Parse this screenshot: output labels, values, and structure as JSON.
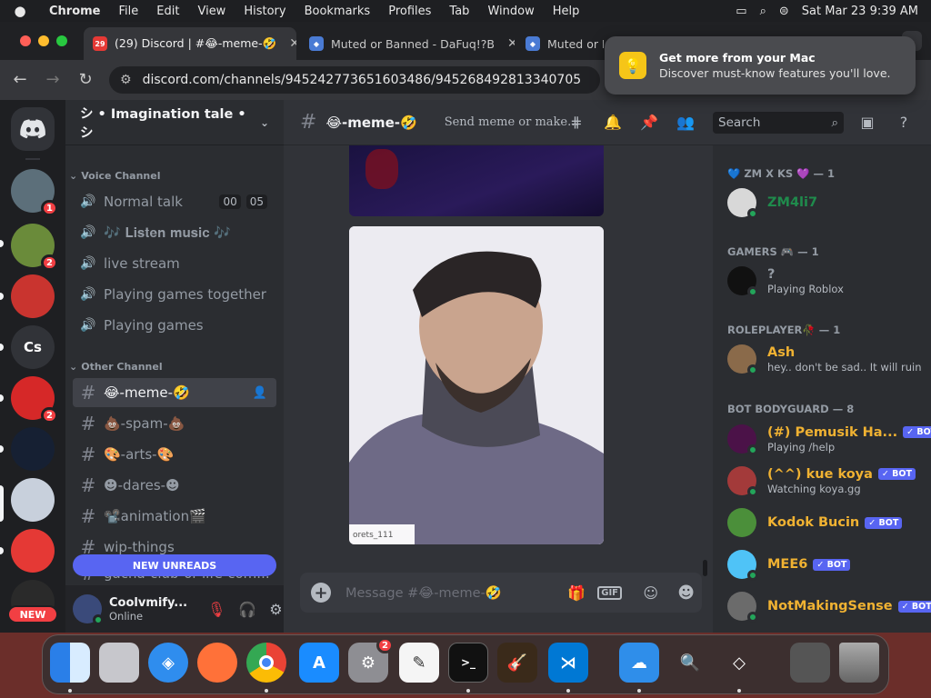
{
  "menubar": {
    "app": "Chrome",
    "items": [
      "File",
      "Edit",
      "View",
      "History",
      "Bookmarks",
      "Profiles",
      "Tab",
      "Window",
      "Help"
    ],
    "datetime": "Sat Mar 23  9:39 AM"
  },
  "browser": {
    "tabs": [
      {
        "title": "(29) Discord | #😂-meme-🤣",
        "favicon": "29"
      },
      {
        "title": "Muted or Banned - DaFuq!?B",
        "favicon": ""
      },
      {
        "title": "Muted or Ba",
        "favicon": ""
      }
    ],
    "url": "discord.com/channels/945242773651603486/945268492813340705"
  },
  "notification": {
    "title": "Get more from your Mac",
    "body": "Discover must-know features you'll love."
  },
  "discord": {
    "server_name": "シ • Imagination tale • シ",
    "guilds": [
      {
        "label": "",
        "badge": "1",
        "color": "#5c6f7a"
      },
      {
        "label": "",
        "badge": "2",
        "color": "#6a8b3a"
      },
      {
        "label": "",
        "badge": "",
        "color": "#c9342f"
      },
      {
        "label": "Cs",
        "badge": "",
        "color": "#313338"
      },
      {
        "label": "",
        "badge": "2",
        "color": "#d62828"
      },
      {
        "label": "",
        "badge": "",
        "color": "#162033"
      },
      {
        "label": "",
        "badge": "",
        "color": "#c8d0dc"
      },
      {
        "label": "",
        "badge": "",
        "color": "#e53935"
      }
    ],
    "new_badge": "NEW",
    "voice_category": "Voice Channel",
    "voice_channels": [
      {
        "name": "Normal talk",
        "timer": [
          "00",
          "05"
        ]
      },
      {
        "name": "🎶 𝐋𝐢𝐬𝐭𝐞𝐧 𝐦𝐮𝐬𝐢𝐜 🎶",
        "timer": []
      },
      {
        "name": "live stream",
        "timer": []
      },
      {
        "name": "Playing games together",
        "timer": []
      },
      {
        "name": "Playing games",
        "timer": []
      }
    ],
    "other_category": "Other Channel",
    "text_channels": [
      {
        "name": "😂-meme-🤣",
        "active": true
      },
      {
        "name": "💩-spam-💩",
        "active": false
      },
      {
        "name": "🎨-arts-🎨",
        "active": false
      },
      {
        "name": "☻-dares-☻",
        "active": false
      },
      {
        "name": "📽️animation🎬",
        "active": false
      },
      {
        "name": "wip-things",
        "active": false
      },
      {
        "name": "gacha-club-or-life-com...",
        "active": false
      }
    ],
    "new_unreads": "NEW UNREADS",
    "user": {
      "name": "Coolvmify...",
      "status": "Online"
    },
    "channel_title": "😂-meme-🤣",
    "channel_topic": "Send meme or make...",
    "search_placeholder": "Search",
    "image_caption": "orets_111",
    "composer_placeholder": "Message #😂-meme-🤣",
    "member_groups": [
      {
        "title": "💙 ZM X KS 💜 — 1",
        "members": [
          {
            "name": "ZM4li7",
            "activity": "",
            "color": "#1f8b4c",
            "bot": false,
            "avatar": "#d8d8d8"
          }
        ]
      },
      {
        "title": "GAMERS 🎮 — 1",
        "members": [
          {
            "name": "?",
            "activity": "Playing Roblox",
            "color": "#949ba4",
            "bot": false,
            "avatar": "#111111"
          }
        ]
      },
      {
        "title": "ROLEPLAYER🥀 — 1",
        "members": [
          {
            "name": "Ash",
            "activity": "hey.. don't be sad.. It will ruin ...",
            "color": "#f0b232",
            "bot": false,
            "avatar": "#8a6a4a"
          }
        ]
      },
      {
        "title": "BOT BODYGUARD — 8",
        "members": [
          {
            "name": "(#) Pemusik Ha...",
            "activity": "Playing /help",
            "color": "#f0b232",
            "bot": true,
            "avatar": "#4b1248"
          },
          {
            "name": "(^^) kue koya",
            "activity": "Watching koya.gg",
            "color": "#f0b232",
            "bot": true,
            "avatar": "#a33a3a"
          },
          {
            "name": "Kodok Bucin",
            "activity": "",
            "color": "#f0b232",
            "bot": true,
            "avatar": "#4b8f3a"
          },
          {
            "name": "MEE6",
            "activity": "",
            "color": "#f0b232",
            "bot": true,
            "avatar": "#4fc3f7"
          },
          {
            "name": "NotMakingSense",
            "activity": "",
            "color": "#f0b232",
            "bot": true,
            "avatar": "#6b6b6b"
          }
        ]
      }
    ],
    "bot_label": "✓ BOT"
  },
  "dock": {
    "apps": [
      "finder",
      "launchpad",
      "safari",
      "firefox",
      "chrome",
      "app-store",
      "system-settings",
      "textedit",
      "terminal",
      "garageband",
      "vscode",
      "weather",
      "preview",
      "unity",
      "screenshots",
      "trash"
    ],
    "settings_badge": "2"
  },
  "colors": {
    "blurple": "#5865f2",
    "online": "#23a55a",
    "danger": "#f23f43"
  }
}
